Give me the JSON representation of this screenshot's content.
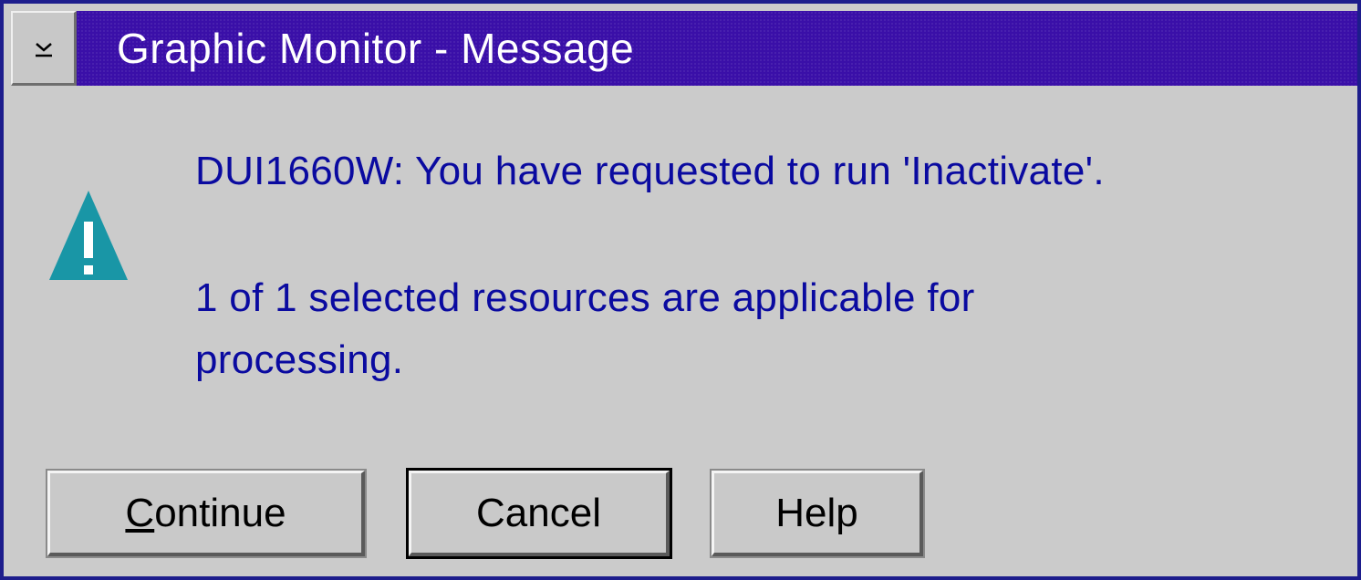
{
  "window": {
    "title": "Graphic Monitor - Message"
  },
  "message": {
    "icon": "warning-icon",
    "line1": "DUI1660W: You have requested to run 'Inactivate'.",
    "line2": "1 of 1 selected resources are applicable for",
    "line3": "processing."
  },
  "buttons": {
    "continue_accel": "C",
    "continue_rest": "ontinue",
    "cancel": "Cancel",
    "help": "Help"
  },
  "colors": {
    "titlebar": "#3a0fa8",
    "message_text": "#0a0aa0",
    "warning_icon": "#1996a6",
    "dialog_bg": "#cbcbcb"
  }
}
